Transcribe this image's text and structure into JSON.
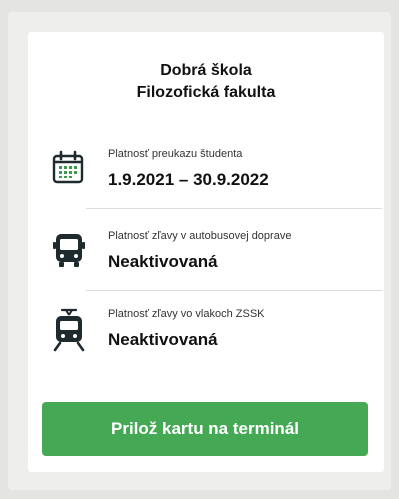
{
  "header": {
    "school": "Dobrá škola",
    "faculty": "Filozofická fakulta"
  },
  "rows": [
    {
      "icon": "calendar-icon",
      "label": "Platnosť preukazu študenta",
      "value": "1.9.2021 – 30.9.2022"
    },
    {
      "icon": "bus-icon",
      "label": "Platnosť zľavy v autobusovej doprave",
      "value": "Neaktivovaná"
    },
    {
      "icon": "train-icon",
      "label": "Platnosť zľavy vo vlakoch ZSSK",
      "value": "Neaktivovaná"
    }
  ],
  "action": {
    "label": "Prilož kartu na terminál"
  },
  "colors": {
    "accent_green": "#45a854",
    "icon_dark": "#1f2a2e",
    "calendar_green": "#3c9a4c"
  }
}
